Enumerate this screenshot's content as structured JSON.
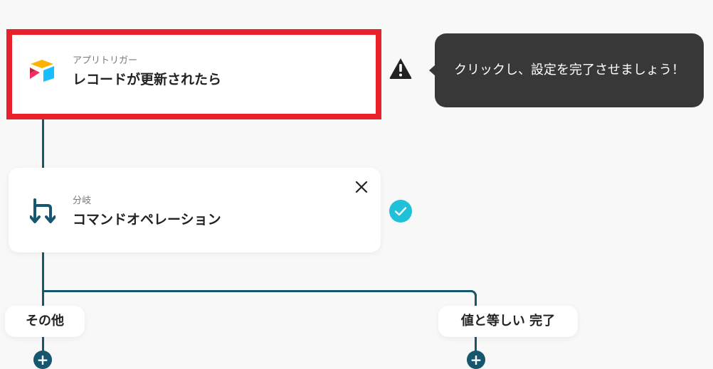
{
  "trigger": {
    "sub_label": "アプリトリガー",
    "title": "レコードが更新されたら"
  },
  "tooltip": {
    "text": "クリックし、設定を完了させましょう！"
  },
  "branch": {
    "sub_label": "分岐",
    "title": "コマンドオペレーション"
  },
  "branches": {
    "left_label": "その他",
    "right_label": "値と等しい 完了"
  },
  "colors": {
    "highlight": "#e8202a",
    "connector": "#16566f",
    "check": "#1fc1d8",
    "warning": "#222222"
  },
  "icons": {
    "trigger_app": "airtable-logo-icon",
    "branch": "branch-icon",
    "warning": "warning-icon",
    "check": "check-circle-icon",
    "close": "close-icon",
    "add": "plus-icon"
  }
}
